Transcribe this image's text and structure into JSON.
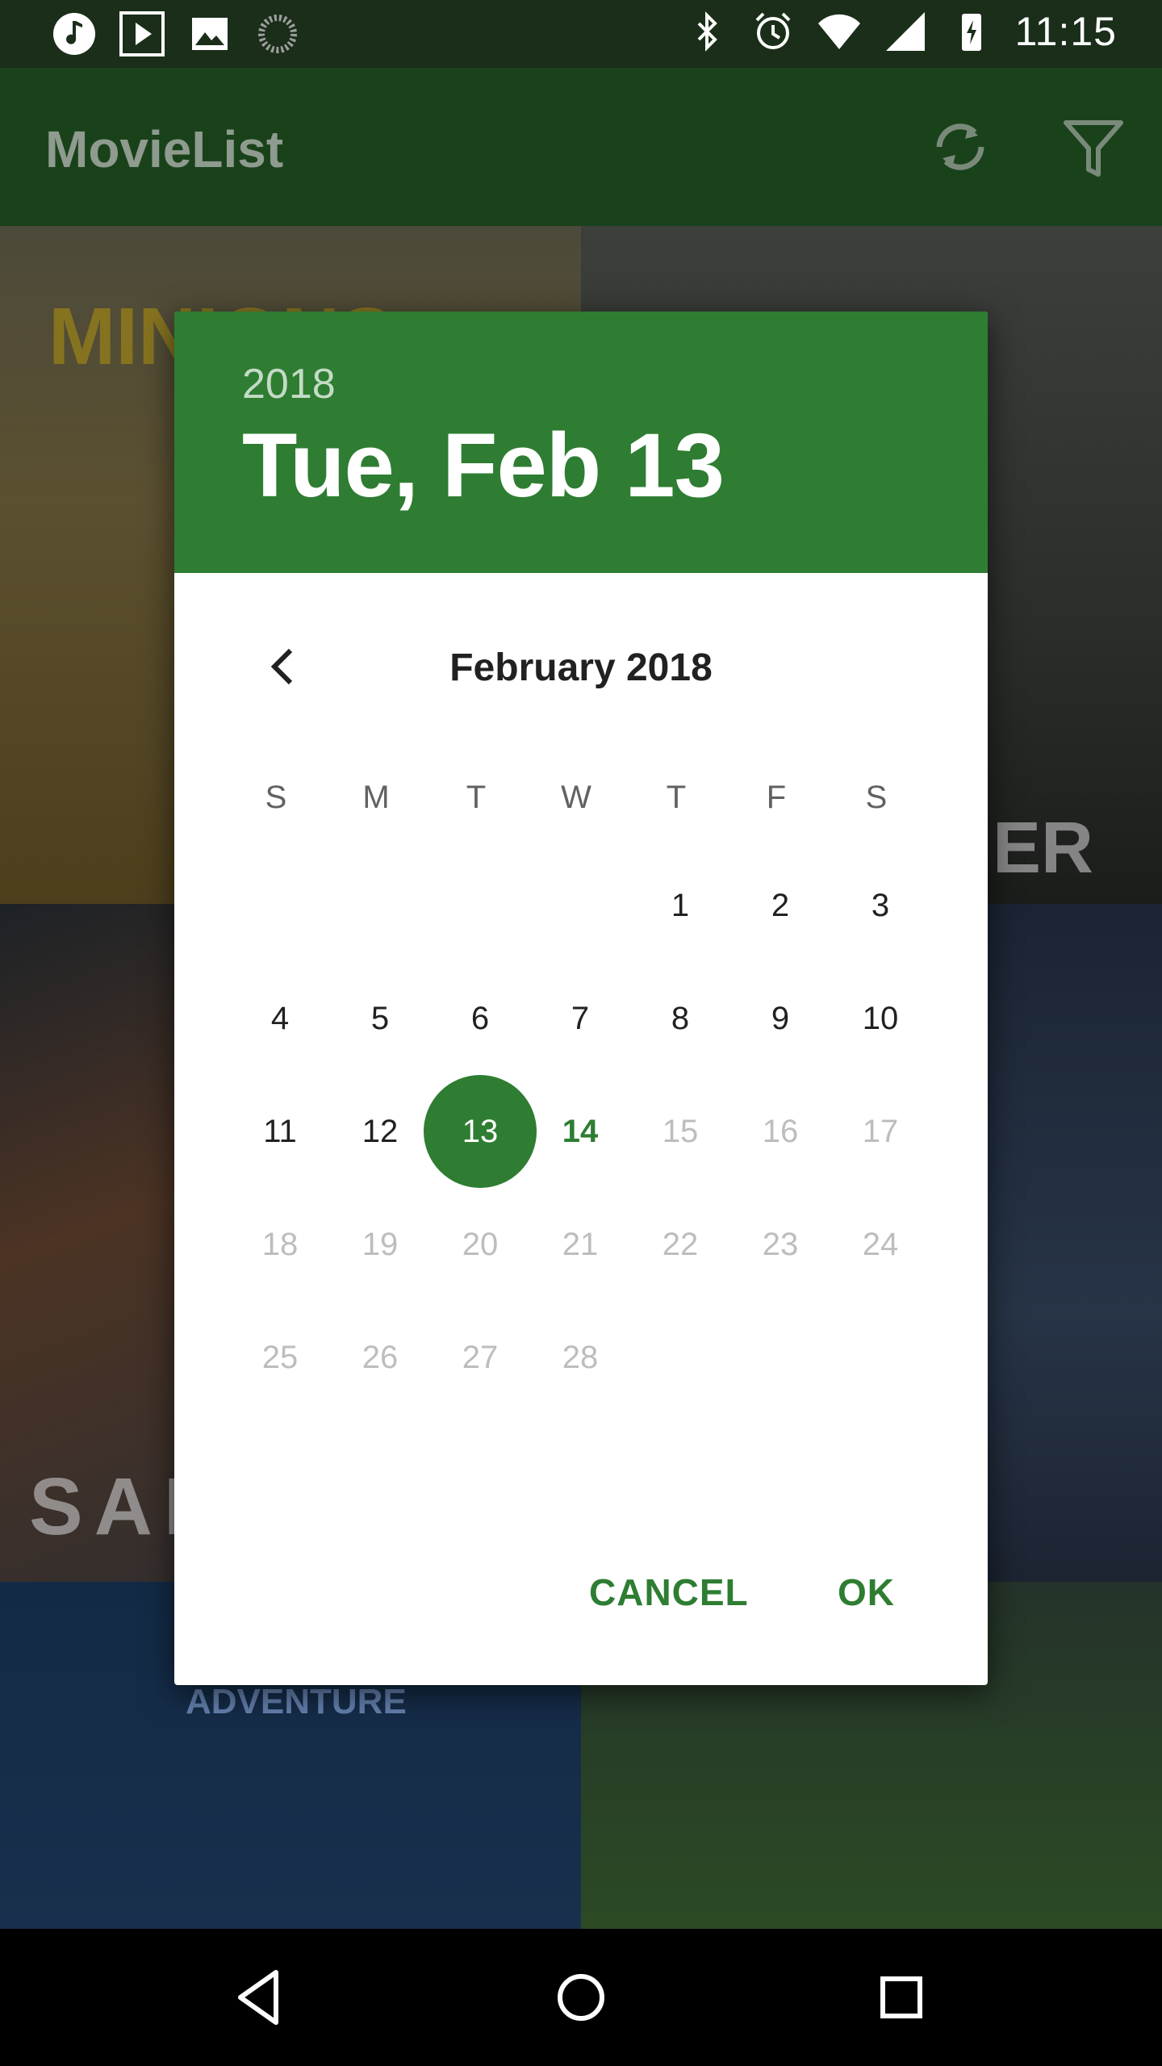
{
  "status_bar": {
    "time": "11:15",
    "left_icons": [
      "music-note-icon",
      "play-store-icon",
      "image-icon",
      "loading-circle-icon"
    ],
    "right_icons": [
      "bluetooth-icon",
      "alarm-icon",
      "wifi-icon",
      "signal-icon",
      "battery-icon"
    ]
  },
  "app_bar": {
    "title": "MovieList",
    "actions": [
      "refresh-icon",
      "filter-icon"
    ]
  },
  "posters": {
    "tile1": "MINIONS",
    "tile2": "ER",
    "tile3": "SAN",
    "tile5": "FROZEN ADVENTURE"
  },
  "dialog": {
    "year": "2018",
    "selected_date": "Tue, Feb 13",
    "month_label": "February 2018",
    "weekdays": [
      "S",
      "M",
      "T",
      "W",
      "T",
      "F",
      "S"
    ],
    "selected_day": "13",
    "today_day": "14",
    "cancel_label": "CANCEL",
    "ok_label": "OK"
  },
  "nav_bar": [
    "back-icon",
    "home-icon",
    "recents-icon"
  ],
  "colors": {
    "primary": "#2e7d32",
    "app_bar_dimmed": "#19421b",
    "disabled_day": "#bdbdbd"
  }
}
